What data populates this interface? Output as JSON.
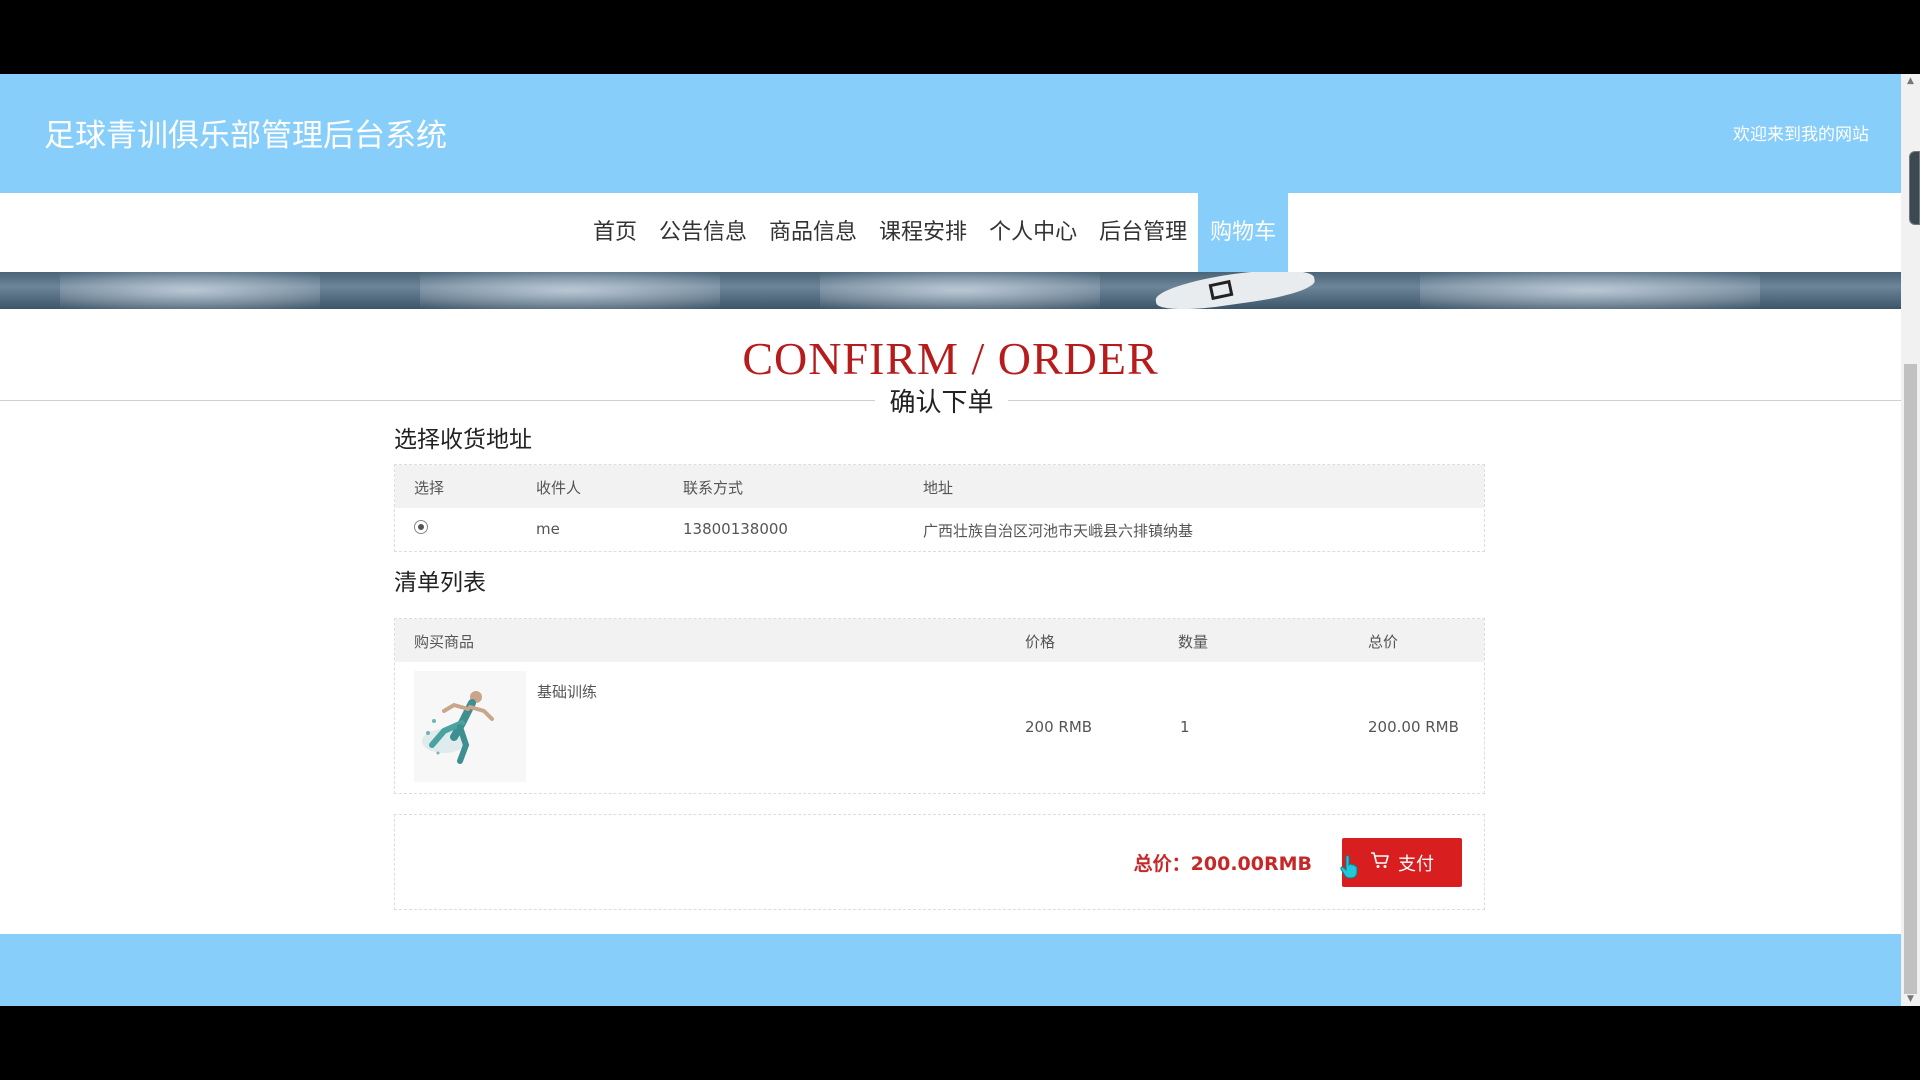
{
  "header": {
    "site_title": "足球青训俱乐部管理后台系统",
    "welcome": "欢迎来到我的网站"
  },
  "nav": {
    "items": [
      "首页",
      "公告信息",
      "商品信息",
      "课程安排",
      "个人中心",
      "后台管理",
      "购物车"
    ],
    "active_index": 6
  },
  "page": {
    "title_en": "CONFIRM / ORDER",
    "title_cn": "确认下单"
  },
  "address_section": {
    "title": "选择收货地址",
    "headers": [
      "选择",
      "收件人",
      "联系方式",
      "地址"
    ],
    "rows": [
      {
        "selected": true,
        "recipient": "me",
        "phone": "13800138000",
        "address": "广西壮族自治区河池市天峨县六排镇纳基"
      }
    ]
  },
  "order_section": {
    "title": "清单列表",
    "headers": [
      "购买商品",
      "价格",
      "数量",
      "总价"
    ],
    "items": [
      {
        "name": "基础训练",
        "price": "200 RMB",
        "quantity": "1",
        "total": "200.00 RMB"
      }
    ]
  },
  "summary": {
    "total_label": "总价：200.00RMB",
    "pay_label": "支付"
  },
  "colors": {
    "header_bg": "#87cefa",
    "accent_red": "#d81e1e",
    "title_red": "#b71c1c"
  }
}
